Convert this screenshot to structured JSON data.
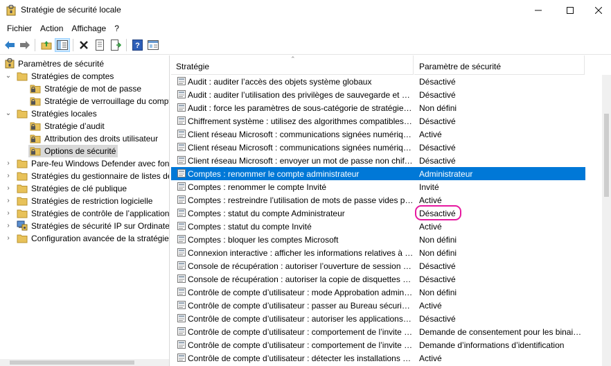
{
  "window": {
    "title": "Stratégie de sécurité locale"
  },
  "menu": [
    "Fichier",
    "Action",
    "Affichage",
    "?"
  ],
  "toolbar_icons": [
    "back-arrow-icon",
    "forward-arrow-icon",
    "up-folder-icon",
    "show-hide-tree-icon",
    "delete-icon",
    "properties-icon",
    "export-list-icon",
    "help-icon",
    "console-icon"
  ],
  "tree": [
    {
      "label": "Paramètres de sécurité",
      "level": 0,
      "expander": "",
      "icon": "security-settings-icon",
      "selected": false
    },
    {
      "label": "Stratégies de comptes",
      "level": 1,
      "expander": "open",
      "icon": "folder-icon",
      "selected": false
    },
    {
      "label": "Stratégie de mot de passe",
      "level": 2,
      "expander": "",
      "icon": "lock-folder-icon",
      "selected": false
    },
    {
      "label": "Stratégie de verrouillage du compte",
      "level": 2,
      "expander": "",
      "icon": "lock-folder-icon",
      "selected": false
    },
    {
      "label": "Stratégies locales",
      "level": 1,
      "expander": "open",
      "icon": "folder-icon",
      "selected": false
    },
    {
      "label": "Stratégie d’audit",
      "level": 2,
      "expander": "",
      "icon": "lock-folder-icon",
      "selected": false
    },
    {
      "label": "Attribution des droits utilisateur",
      "level": 2,
      "expander": "",
      "icon": "lock-folder-icon",
      "selected": false
    },
    {
      "label": "Options de sécurité",
      "level": 2,
      "expander": "",
      "icon": "lock-folder-icon",
      "selected": true
    },
    {
      "label": "Pare-feu Windows Defender avec fonctions avancées de sécurité",
      "level": 1,
      "expander": "closed",
      "icon": "folder-icon",
      "selected": false
    },
    {
      "label": "Stratégies du gestionnaire de listes de réseaux",
      "level": 1,
      "expander": "closed",
      "icon": "folder-icon",
      "selected": false
    },
    {
      "label": "Stratégies de clé publique",
      "level": 1,
      "expander": "closed",
      "icon": "folder-icon",
      "selected": false
    },
    {
      "label": "Stratégies de restriction logicielle",
      "level": 1,
      "expander": "closed",
      "icon": "folder-icon",
      "selected": false
    },
    {
      "label": "Stratégies de contrôle de l’application",
      "level": 1,
      "expander": "closed",
      "icon": "folder-icon",
      "selected": false
    },
    {
      "label": "Stratégies de sécurité IP sur Ordinateur local",
      "level": 1,
      "expander": "closed",
      "icon": "ip-security-icon",
      "selected": false
    },
    {
      "label": "Configuration avancée de la stratégie d’audit",
      "level": 1,
      "expander": "closed",
      "icon": "folder-icon",
      "selected": false
    }
  ],
  "columns": {
    "policy": "Stratégie",
    "setting": "Paramètre de sécurité"
  },
  "rows": [
    {
      "policy": "Audit : auditer l’accès des objets système globaux",
      "setting": "Désactivé",
      "selected": false,
      "highlighted": false
    },
    {
      "policy": "Audit : auditer l’utilisation des privilèges de sauvegarde et de restauration",
      "setting": "Désactivé",
      "selected": false,
      "highlighted": false
    },
    {
      "policy": "Audit : force les paramètres de sous-catégorie de stratégie d’audit",
      "setting": "Non défini",
      "selected": false,
      "highlighted": false
    },
    {
      "policy": "Chiffrement système : utilisez des algorithmes compatibles FIPS",
      "setting": "Désactivé",
      "selected": false,
      "highlighted": false
    },
    {
      "policy": "Client réseau Microsoft : communications signées numériquement (toujours)",
      "setting": "Activé",
      "selected": false,
      "highlighted": false
    },
    {
      "policy": "Client réseau Microsoft : communications signées numériquement (lorsque le serveur l’accepte)",
      "setting": "Désactivé",
      "selected": false,
      "highlighted": false
    },
    {
      "policy": "Client réseau Microsoft : envoyer un mot de passe non chiffré aux serveurs SMB tiers",
      "setting": "Désactivé",
      "selected": false,
      "highlighted": false
    },
    {
      "policy": "Comptes : renommer le compte administrateur",
      "setting": "Administrateur",
      "selected": true,
      "highlighted": false
    },
    {
      "policy": "Comptes : renommer le compte Invité",
      "setting": "Invité",
      "selected": false,
      "highlighted": false
    },
    {
      "policy": "Comptes : restreindre l’utilisation de mots de passe vides par le compte local",
      "setting": "Activé",
      "selected": false,
      "highlighted": false
    },
    {
      "policy": "Comptes : statut du compte Administrateur",
      "setting": "Désactivé",
      "selected": false,
      "highlighted": true
    },
    {
      "policy": "Comptes : statut du compte Invité",
      "setting": "Activé",
      "selected": false,
      "highlighted": false
    },
    {
      "policy": "Comptes : bloquer les comptes Microsoft",
      "setting": "Non défini",
      "selected": false,
      "highlighted": false
    },
    {
      "policy": "Connexion interactive : afficher les informations relatives à l’utilisateur",
      "setting": "Non défini",
      "selected": false,
      "highlighted": false
    },
    {
      "policy": "Console de récupération : autoriser l’ouverture de session d’administration",
      "setting": "Désactivé",
      "selected": false,
      "highlighted": false
    },
    {
      "policy": "Console de récupération : autoriser la copie de disquettes et l’accès à tous les lecteurs",
      "setting": "Désactivé",
      "selected": false,
      "highlighted": false
    },
    {
      "policy": "Contrôle de compte d’utilisateur : mode Approbation administrateur",
      "setting": "Non défini",
      "selected": false,
      "highlighted": false
    },
    {
      "policy": "Contrôle de compte d’utilisateur : passer au Bureau sécurisé lors d’une demande",
      "setting": "Activé",
      "selected": false,
      "highlighted": false
    },
    {
      "policy": "Contrôle de compte d’utilisateur : autoriser les applications UIAccess",
      "setting": "Désactivé",
      "selected": false,
      "highlighted": false
    },
    {
      "policy": "Contrôle de compte d’utilisateur : comportement de l’invite d’élévation pour les administrateurs",
      "setting": "Demande de consentement pour les binaires non Windows",
      "selected": false,
      "highlighted": false
    },
    {
      "policy": "Contrôle de compte d’utilisateur : comportement de l’invite d’élévation pour les utilisateurs standard",
      "setting": "Demande d’informations d’identification",
      "selected": false,
      "highlighted": false
    },
    {
      "policy": "Contrôle de compte d’utilisateur : détecter les installations d’applications",
      "setting": "Activé",
      "selected": false,
      "highlighted": false
    }
  ],
  "colors": {
    "selection": "#0078d7",
    "tree_selection": "#d9d9d9",
    "highlight_oval": "#e6199f",
    "folder": "#e8c25a"
  }
}
